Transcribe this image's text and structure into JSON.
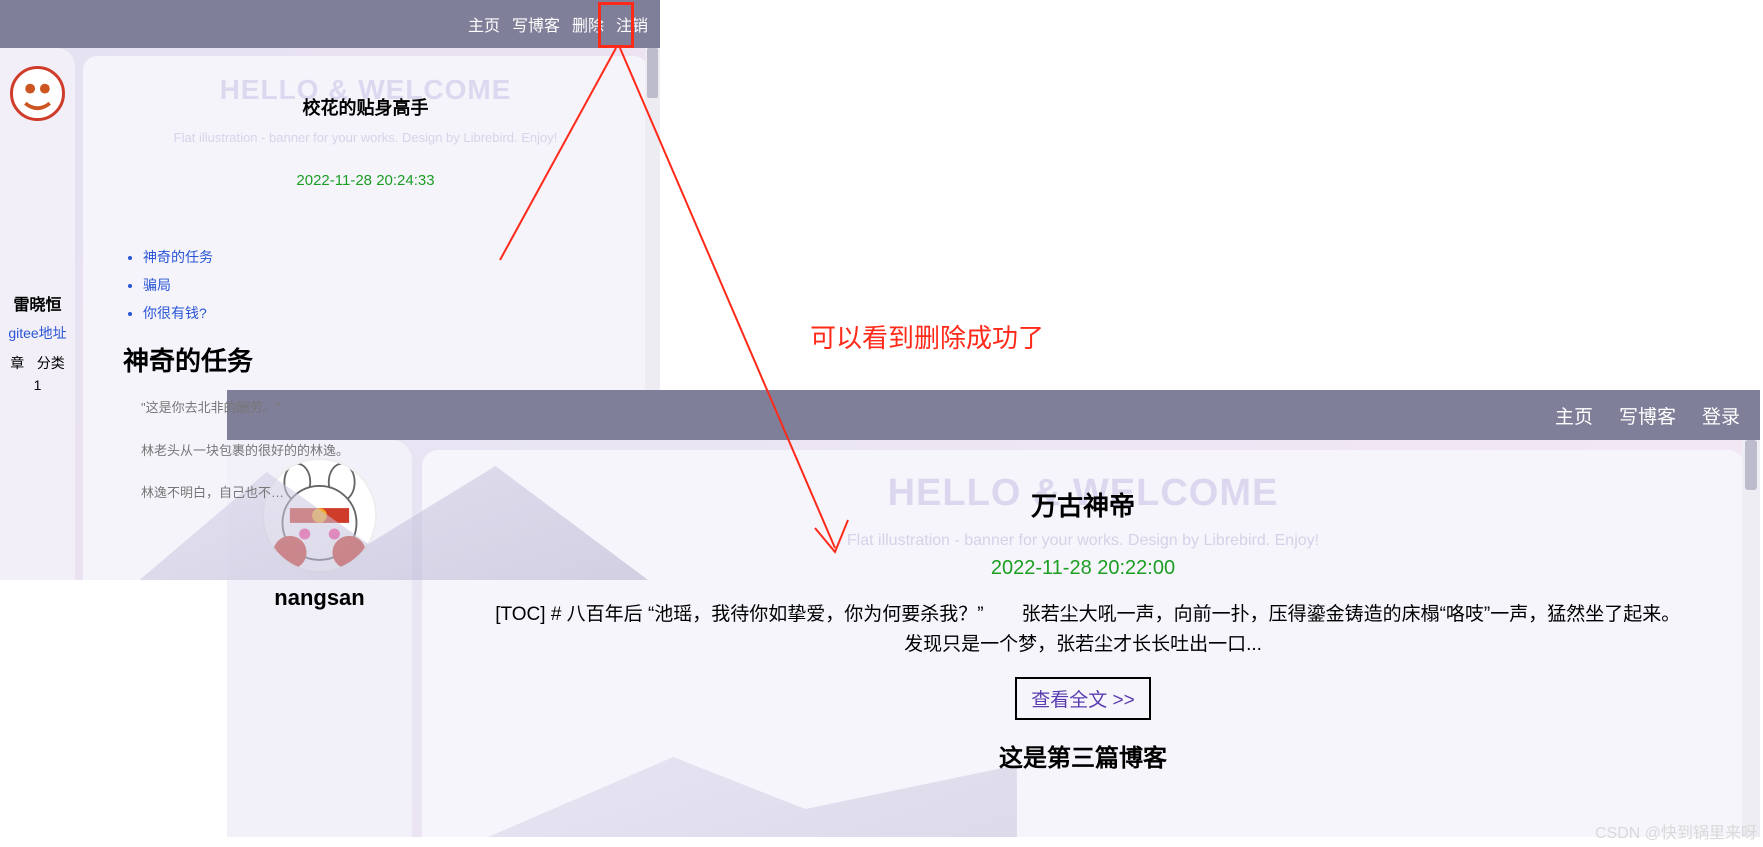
{
  "annotation": {
    "text": "可以看到删除成功了"
  },
  "watermark": "CSDN @快到锅里来呀",
  "shot1": {
    "nav": {
      "home": "主页",
      "write": "写博客",
      "delete": "删除",
      "logout": "注销"
    },
    "hero": {
      "hello": "HELLO & WELCOME",
      "sub": "Flat illustration - banner for your works. Design by Librebird. Enjoy!"
    },
    "sidebar": {
      "name": "雷晓恒",
      "gitee": "gitee地址",
      "col_article": "章",
      "col_category": "分类",
      "count": "1"
    },
    "post": {
      "title": "校花的贴身高手",
      "date": "2022-11-28 20:24:33",
      "links": {
        "a": "神奇的任务",
        "b": "骗局",
        "c": "你很有钱?"
      },
      "h2": "神奇的任务",
      "p1": "\"这是你去北非的酬劳。\"",
      "p2": "林老头从一块包裹的很好的的林逸。",
      "p3": "林逸不明白，自己也不…"
    }
  },
  "shot2": {
    "nav": {
      "home": "主页",
      "write": "写博客",
      "login": "登录"
    },
    "hero": {
      "hello": "HELLO & WELCOME",
      "sub": "Flat illustration - banner for your works. Design by Librebird. Enjoy!"
    },
    "sidebar": {
      "name": "nangsan"
    },
    "post": {
      "title": "万古神帝",
      "date": "2022-11-28 20:22:00",
      "body": "[TOC] # 八百年后 “池瑶，我待你如挚爱，你为何要杀我？”　　张若尘大吼一声，向前一扑，压得鎏金铸造的床榻“咯吱”一声，猛然坐了起来。　　发现只是一个梦，张若尘才长长吐出一口...",
      "view": "查看全文 >>",
      "next": "这是第三篇博客"
    }
  }
}
